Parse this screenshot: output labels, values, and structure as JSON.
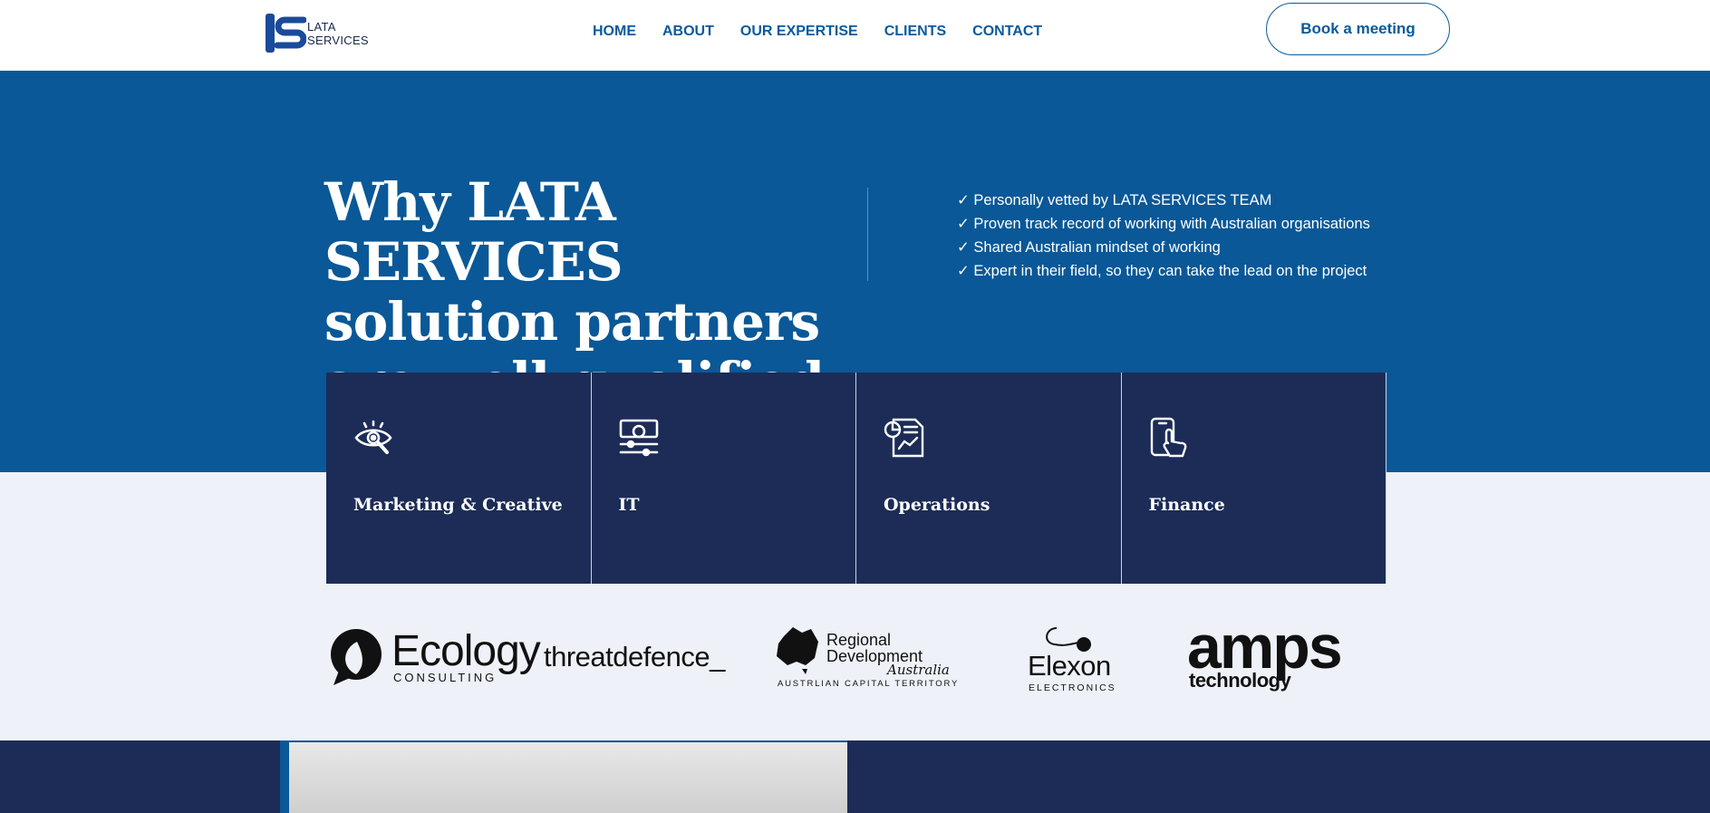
{
  "header": {
    "logo": {
      "line1": "LATA",
      "line2": "SERVICES"
    },
    "nav": [
      "HOME",
      "ABOUT",
      "OUR EXPERTISE",
      "CLIENTS",
      "CONTACT"
    ],
    "book_button": "Book a meeting"
  },
  "hero": {
    "title": "Why LATA SERVICES solution partners are well-qualified",
    "checks": [
      "✓ Personally vetted by LATA SERVICES TEAM",
      "✓ Proven track record of working with Australian organisations",
      "✓ Shared Australian mindset of working",
      "✓ Expert in their field, so they can take the lead on the project"
    ]
  },
  "cards": [
    {
      "title": "Marketing & Creative",
      "icon": "eye-icon"
    },
    {
      "title": "IT",
      "icon": "settings-sliders-icon"
    },
    {
      "title": "Operations",
      "icon": "report-chart-icon"
    },
    {
      "title": "Finance",
      "icon": "phone-tap-icon"
    }
  ],
  "client_logos": {
    "ecology": {
      "name": "Ecology",
      "sub": "CONSULTING"
    },
    "threatdefence": "threatdefence_",
    "rda": {
      "line1": "Regional",
      "line2": "Development",
      "script": "Australia",
      "sub": "AUSTRLIAN CAPITAL TERRITORY"
    },
    "elexon": {
      "name": "Elexon",
      "sub": "ELECTRONICS"
    },
    "amps": {
      "name": "amps",
      "sub": "technology"
    }
  },
  "colors": {
    "primary": "#0a5897",
    "navy": "#1c2c57",
    "background": "#eef2f8"
  }
}
